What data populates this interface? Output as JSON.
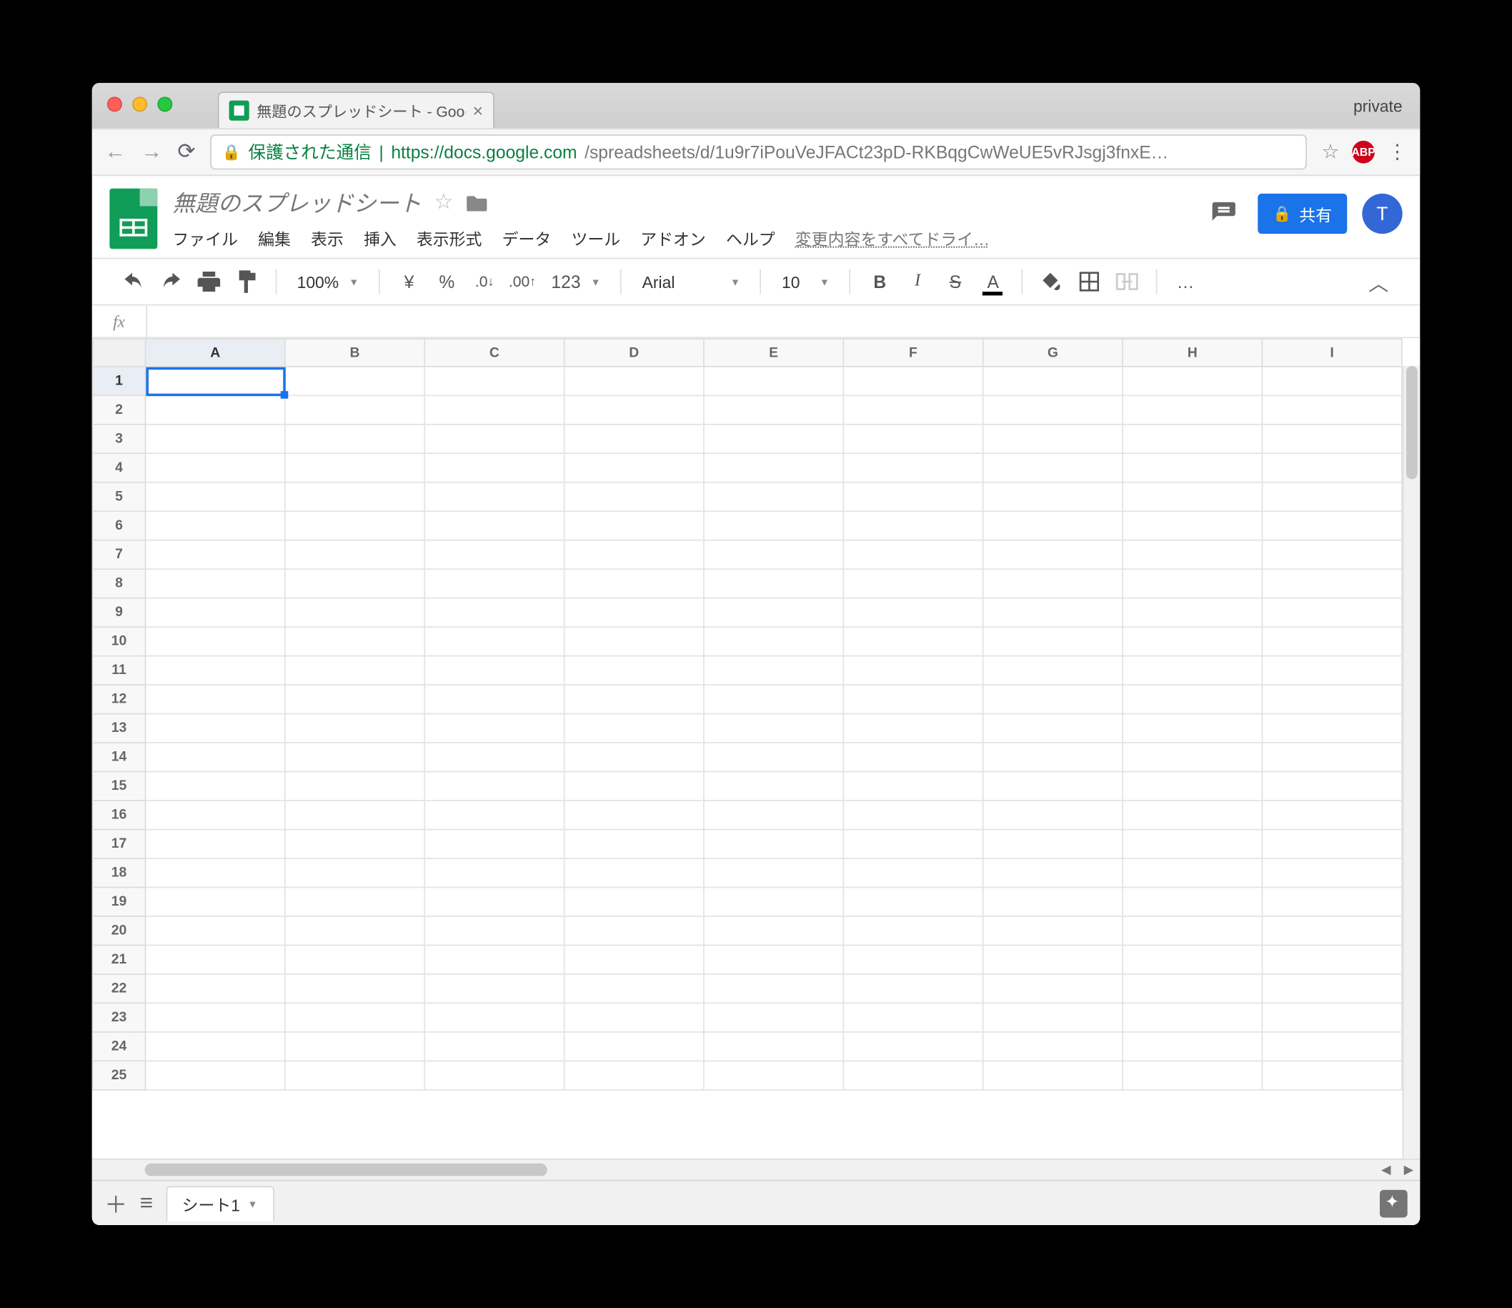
{
  "browser": {
    "tab_title": "無題のスプレッドシート - Google",
    "mode_label": "private",
    "secure_label": "保護された通信",
    "url_host": "https://docs.google.com",
    "url_path": "/spreadsheets/d/1u9r7iPouVeJFACt23pD-RKBqgCwWeUE5vRJsgj3fnxE…",
    "abp_label": "ABP"
  },
  "header": {
    "doc_title": "無題のスプレッドシート",
    "menus": [
      "ファイル",
      "編集",
      "表示",
      "挿入",
      "表示形式",
      "データ",
      "ツール",
      "アドオン",
      "ヘルプ"
    ],
    "save_status": "変更内容をすべてドライ…",
    "share_label": "共有",
    "avatar_initial": "T"
  },
  "toolbar": {
    "zoom": "100%",
    "currency": "¥",
    "percent": "%",
    "dec_less": ".0",
    "dec_more": ".00",
    "numfmt": "123",
    "font": "Arial",
    "font_size": "10",
    "bold": "B",
    "italic": "I",
    "strike": "S",
    "textcolor": "A",
    "more": "…"
  },
  "formula_bar": {
    "fx_label": "fx",
    "value": ""
  },
  "grid": {
    "columns": [
      "A",
      "B",
      "C",
      "D",
      "E",
      "F",
      "G",
      "H",
      "I"
    ],
    "rows": 25,
    "active_cell": "A1"
  },
  "sheetbar": {
    "sheet1": "シート1"
  }
}
